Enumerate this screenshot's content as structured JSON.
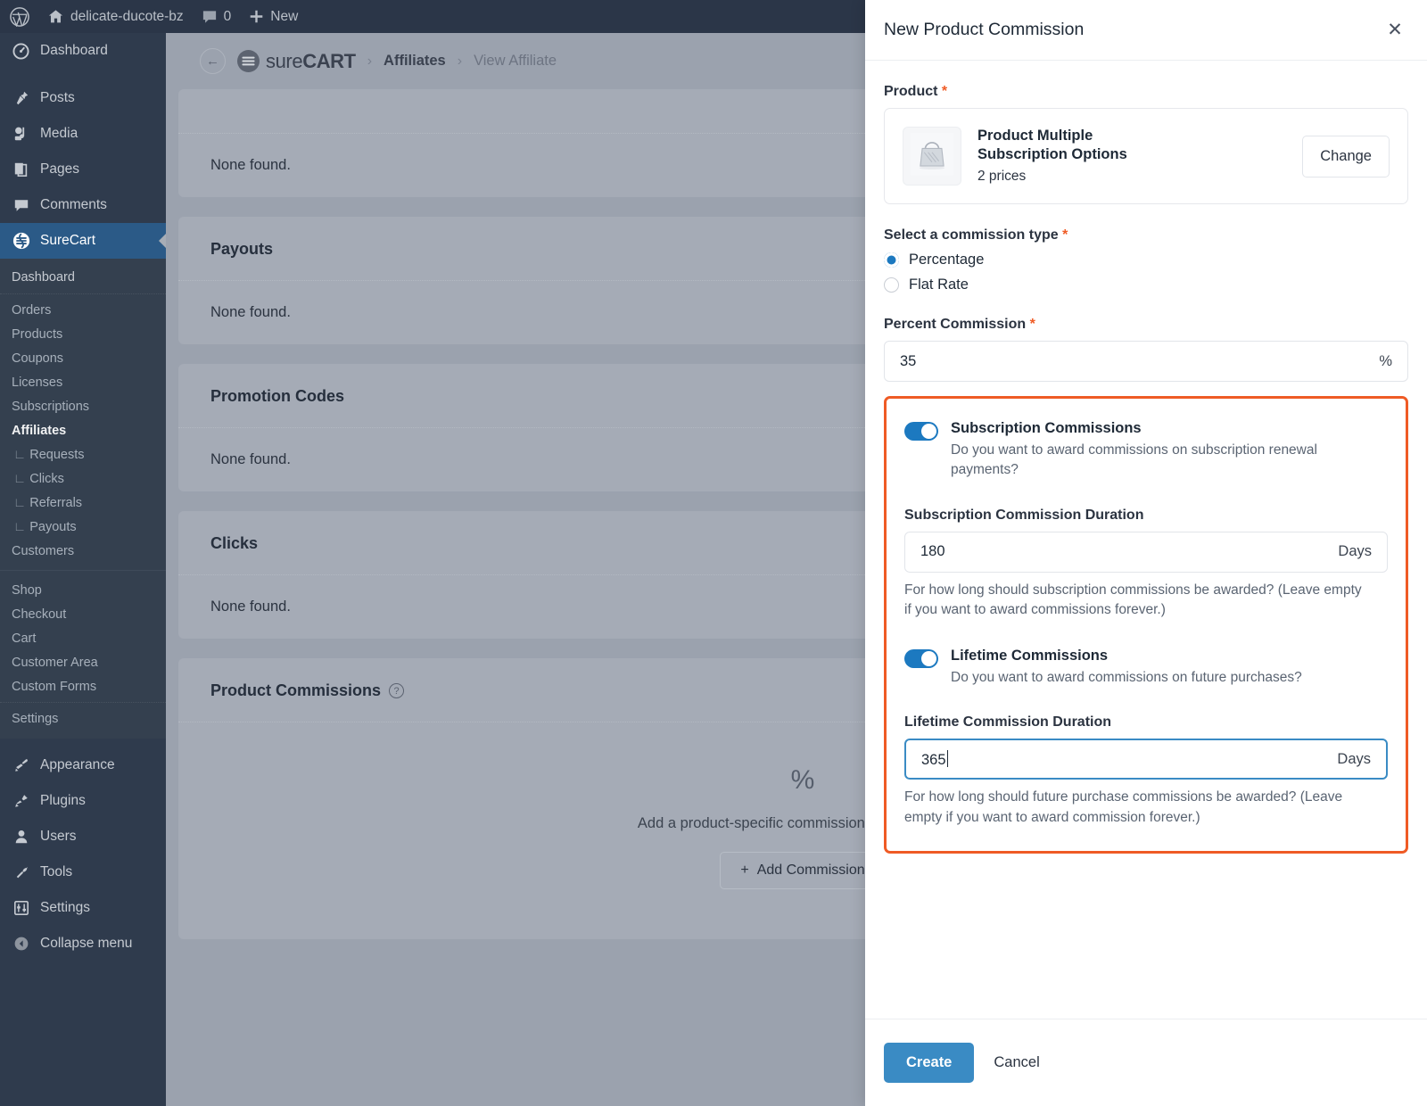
{
  "adminbar": {
    "site_name": "delicate-ducote-bz",
    "comment_count": "0",
    "new_label": "New",
    "wp_logo_icon": "wordpress-logo-icon",
    "home_icon": "home-icon",
    "comment_icon": "comment-bubble-icon",
    "plus_icon": "plus-icon"
  },
  "sidebar": {
    "top_items": [
      {
        "label": "Dashboard",
        "icon": "dashboard-icon"
      },
      {
        "label": "Posts",
        "icon": "pin-icon"
      },
      {
        "label": "Media",
        "icon": "media-icon"
      },
      {
        "label": "Pages",
        "icon": "pages-icon"
      },
      {
        "label": "Comments",
        "icon": "comment-icon"
      },
      {
        "label": "SureCart",
        "icon": "surecart-icon"
      }
    ],
    "submenu_head": "Dashboard",
    "sub_items": [
      {
        "label": "Orders",
        "nested": false,
        "active": false
      },
      {
        "label": "Products",
        "nested": false,
        "active": false
      },
      {
        "label": "Coupons",
        "nested": false,
        "active": false
      },
      {
        "label": "Licenses",
        "nested": false,
        "active": false
      },
      {
        "label": "Subscriptions",
        "nested": false,
        "active": false
      },
      {
        "label": "Affiliates",
        "nested": false,
        "active": true
      },
      {
        "label": "Requests",
        "nested": true,
        "active": false
      },
      {
        "label": "Clicks",
        "nested": true,
        "active": false
      },
      {
        "label": "Referrals",
        "nested": true,
        "active": false
      },
      {
        "label": "Payouts",
        "nested": true,
        "active": false
      },
      {
        "label": "Customers",
        "nested": false,
        "active": false
      }
    ],
    "sub_items_2": [
      {
        "label": "Shop"
      },
      {
        "label": "Checkout"
      },
      {
        "label": "Cart"
      },
      {
        "label": "Customer Area"
      },
      {
        "label": "Custom Forms"
      }
    ],
    "settings_label": "Settings",
    "bottom_items": [
      {
        "label": "Appearance",
        "icon": "brush-icon"
      },
      {
        "label": "Plugins",
        "icon": "plug-icon"
      },
      {
        "label": "Users",
        "icon": "user-icon"
      },
      {
        "label": "Tools",
        "icon": "wrench-icon"
      },
      {
        "label": "Settings",
        "icon": "settings-slider-icon"
      },
      {
        "label": "Collapse menu",
        "icon": "collapse-arrow-icon"
      }
    ]
  },
  "page": {
    "back_icon": "back-arrow-icon",
    "brand_sure": "sure",
    "brand_cart": "CART",
    "crumb_sep": "›",
    "breadcrumb_1": "Affiliates",
    "breadcrumb_2": "View Affiliate",
    "cards": [
      {
        "title": "",
        "empty": "None found."
      },
      {
        "title": "Payouts",
        "empty": "None found."
      },
      {
        "title": "Promotion Codes",
        "empty": "None found."
      },
      {
        "title": "Clicks",
        "empty": "None found."
      }
    ],
    "commissions_card": {
      "title": "Product Commissions",
      "help_icon": "question-mark-icon",
      "percent_glyph": "%",
      "empty_text": "Add a product-specific commission for this affiliate.",
      "add_button": "Add Commission",
      "add_icon": "plus-icon"
    }
  },
  "panel": {
    "title": "New Product Commission",
    "close_icon": "close-icon",
    "product": {
      "label": "Product",
      "required_mark": "*",
      "thumb_icon": "tote-bag-icon",
      "name": "Product Multiple Subscription Options",
      "prices": "2 prices",
      "change_button": "Change"
    },
    "commission_type": {
      "label": "Select a commission type",
      "required_mark": "*",
      "options": [
        {
          "label": "Percentage",
          "selected": true
        },
        {
          "label": "Flat Rate",
          "selected": false
        }
      ]
    },
    "percent_commission": {
      "label": "Percent Commission",
      "required_mark": "*",
      "value": "35",
      "suffix": "%"
    },
    "subscription": {
      "toggle_label": "Subscription Commissions",
      "toggle_on": true,
      "toggle_desc": "Do you want to award commissions on subscription renewal payments?",
      "duration_label": "Subscription Commission Duration",
      "duration_value": "180",
      "duration_suffix": "Days",
      "duration_help": "For how long should subscription commissions be awarded? (Leave empty if you want to award commissions forever.)"
    },
    "lifetime": {
      "toggle_label": "Lifetime Commissions",
      "toggle_on": true,
      "toggle_desc": "Do you want to award commissions on future purchases?",
      "duration_label": "Lifetime Commission Duration",
      "duration_value": "365",
      "duration_suffix": "Days",
      "duration_help": "For how long should future purchase commissions be awarded? (Leave empty if you want to award commission forever.)"
    },
    "footer": {
      "create_label": "Create",
      "cancel_label": "Cancel"
    }
  },
  "colors": {
    "accent_orange": "#ef5b25",
    "accent_blue": "#1c79c0",
    "primary_button": "#3a8bc4",
    "sidebar_bg": "#2f3b4d",
    "adminbar_bg": "#2b3648",
    "sidebar_current": "#2b5a87"
  }
}
